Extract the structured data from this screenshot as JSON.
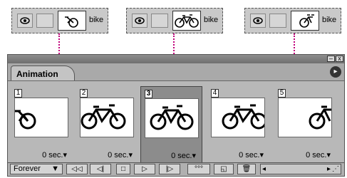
{
  "layers": [
    {
      "name": "bike"
    },
    {
      "name": "bike"
    },
    {
      "name": "bike"
    }
  ],
  "panel": {
    "tab_label": "Animation",
    "window_min": "–",
    "window_close": "x",
    "menu_arrow": "▸"
  },
  "frames": [
    {
      "number": "1",
      "delay": "0 sec.▾"
    },
    {
      "number": "2",
      "delay": "0 sec.▾"
    },
    {
      "number": "3",
      "delay": "0 sec.▾"
    },
    {
      "number": "4",
      "delay": "0 sec.▾"
    },
    {
      "number": "5",
      "delay": "0 sec.▾"
    }
  ],
  "controls": {
    "loop_label": "Forever",
    "loop_arrow": "▼",
    "first_frame": "◁◁",
    "prev_frame": "◁|",
    "stop": "□",
    "play": "▷",
    "next_frame": "|▷",
    "tween": "°°°",
    "duplicate": "◱",
    "delete": "🗑"
  },
  "colors": {
    "dotted_link": "#c0007a",
    "selected_frame": "#8c8c8c"
  }
}
